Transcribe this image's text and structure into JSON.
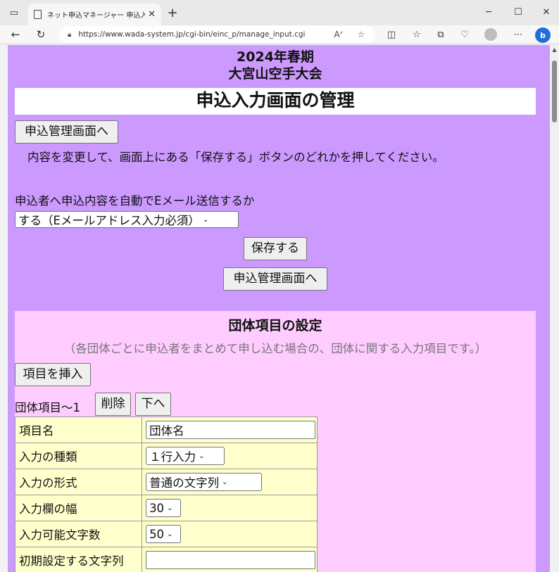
{
  "browser": {
    "tab_title": "ネット申込マネージャー 申込入力画面",
    "url": "https://www.wada-system.jp/cgi-bin/einc_p/manage_input.cgi"
  },
  "page": {
    "event_year": "2024年春期",
    "event_name": "大宮山空手大会",
    "title": "申込入力画面の管理",
    "to_manage_button": "申込管理画面へ",
    "instruction": "内容を変更して、画面上にある「保存する」ボタンのどれかを押してください。",
    "email_question": "申込者へ申込内容を自動でEメール送信するか",
    "email_option": "する（Eメールアドレス入力必須）",
    "save_button": "保存する",
    "to_manage_button2": "申込管理画面へ"
  },
  "group": {
    "heading": "団体項目の設定",
    "description": "（各団体ごとに申込者をまとめて申し込む場合の、団体に関する入力項目です。）",
    "insert_button": "項目を挿入",
    "item_label": "団体項目〜1",
    "delete_button": "削除",
    "down_button": "下へ",
    "rows": [
      {
        "name": "項目名",
        "value": "団体名"
      },
      {
        "name": "入力の種類",
        "value": "１行入力"
      },
      {
        "name": "入力の形式",
        "value": "普通の文字列"
      },
      {
        "name": "入力欄の幅",
        "value": "30"
      },
      {
        "name": "入力可能文字数",
        "value": "50"
      },
      {
        "name": "初期設定する文字列",
        "value": ""
      }
    ]
  },
  "colors": {
    "page_bg": "#cc99ff",
    "group_bg": "#ffccff",
    "table_bg": "#ffffcc"
  }
}
